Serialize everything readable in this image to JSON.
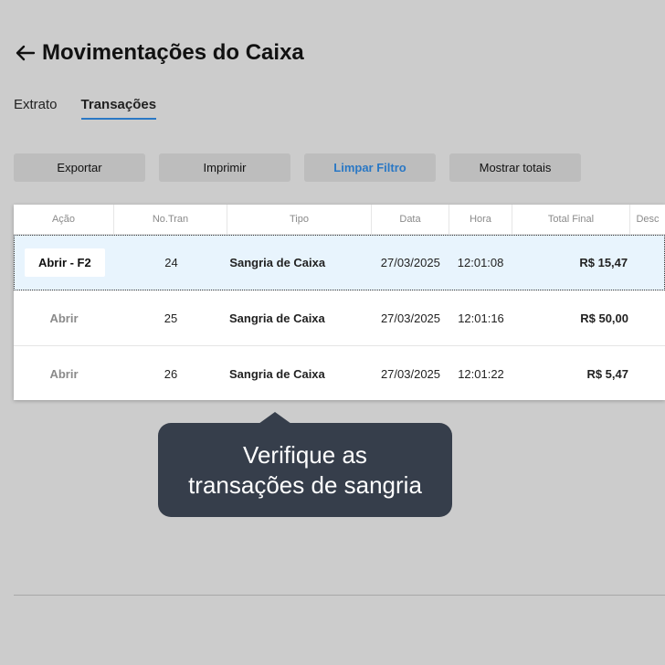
{
  "header": {
    "title": "Movimentações do Caixa",
    "back_icon": "arrow-left-icon"
  },
  "tabs": [
    {
      "label": "Extrato",
      "active": false
    },
    {
      "label": "Transações",
      "active": true
    }
  ],
  "toolbar": {
    "export_label": "Exportar",
    "print_label": "Imprimir",
    "clear_filter_label": "Limpar Filtro",
    "show_totals_label": "Mostrar totais"
  },
  "table": {
    "columns": [
      "Ação",
      "No.Tran",
      "Tipo",
      "Data",
      "Hora",
      "Total Final",
      "Desc"
    ],
    "rows": [
      {
        "action": "Abrir - F2",
        "no": "24",
        "tipo": "Sangria de Caixa",
        "data": "27/03/2025",
        "hora": "12:01:08",
        "total": "R$ 15,47"
      },
      {
        "action": "Abrir",
        "no": "25",
        "tipo": "Sangria de Caixa",
        "data": "27/03/2025",
        "hora": "12:01:16",
        "total": "R$ 50,00"
      },
      {
        "action": "Abrir",
        "no": "26",
        "tipo": "Sangria de Caixa",
        "data": "27/03/2025",
        "hora": "12:01:22",
        "total": "R$ 5,47"
      }
    ]
  },
  "tooltip": {
    "text_line1": "Verifique as",
    "text_line2": "transações de sangria"
  },
  "colors": {
    "background": "#cccccc",
    "accent": "#2a78c5",
    "selected_row": "#e8f4fd",
    "tooltip_bg": "#363e4b"
  }
}
